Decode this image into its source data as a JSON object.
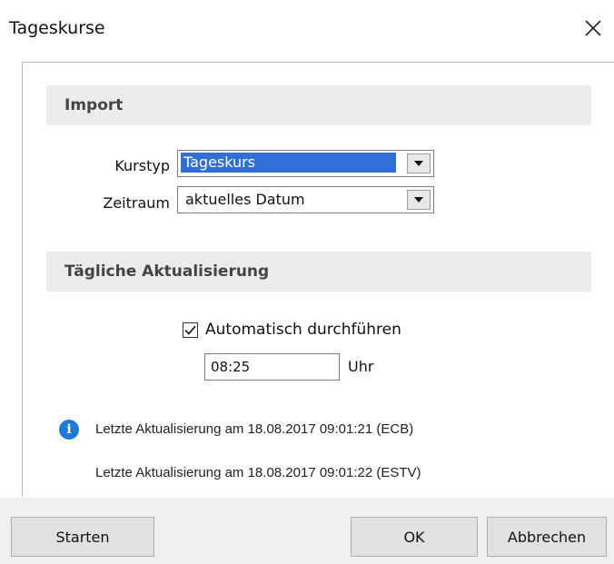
{
  "window": {
    "title": "Tageskurse",
    "close_icon": "close-icon"
  },
  "import_section": {
    "header": "Import",
    "kurstyp": {
      "label": "Kurstyp",
      "value": "Tageskurs"
    },
    "zeitraum": {
      "label": "Zeitraum",
      "value": "aktuelles Datum"
    }
  },
  "daily_section": {
    "header": "Tägliche Aktualisierung",
    "auto": {
      "label": "Automatisch durchführen",
      "checked": true
    },
    "time": {
      "value": "08:25",
      "unit": "Uhr"
    }
  },
  "status": {
    "icon": "info-icon",
    "line1": "Letzte Aktualisierung am 18.08.2017 09:01:21 (ECB)",
    "line2": "Letzte Aktualisierung am 18.08.2017 09:01:22 (ESTV)"
  },
  "buttons": {
    "start": "Starten",
    "ok": "OK",
    "cancel": "Abbrechen"
  },
  "colors": {
    "selection": "#2f6fd6",
    "info": "#1e7ad6",
    "section_bg": "#ececec",
    "footer_bg": "#f0f0f0"
  }
}
